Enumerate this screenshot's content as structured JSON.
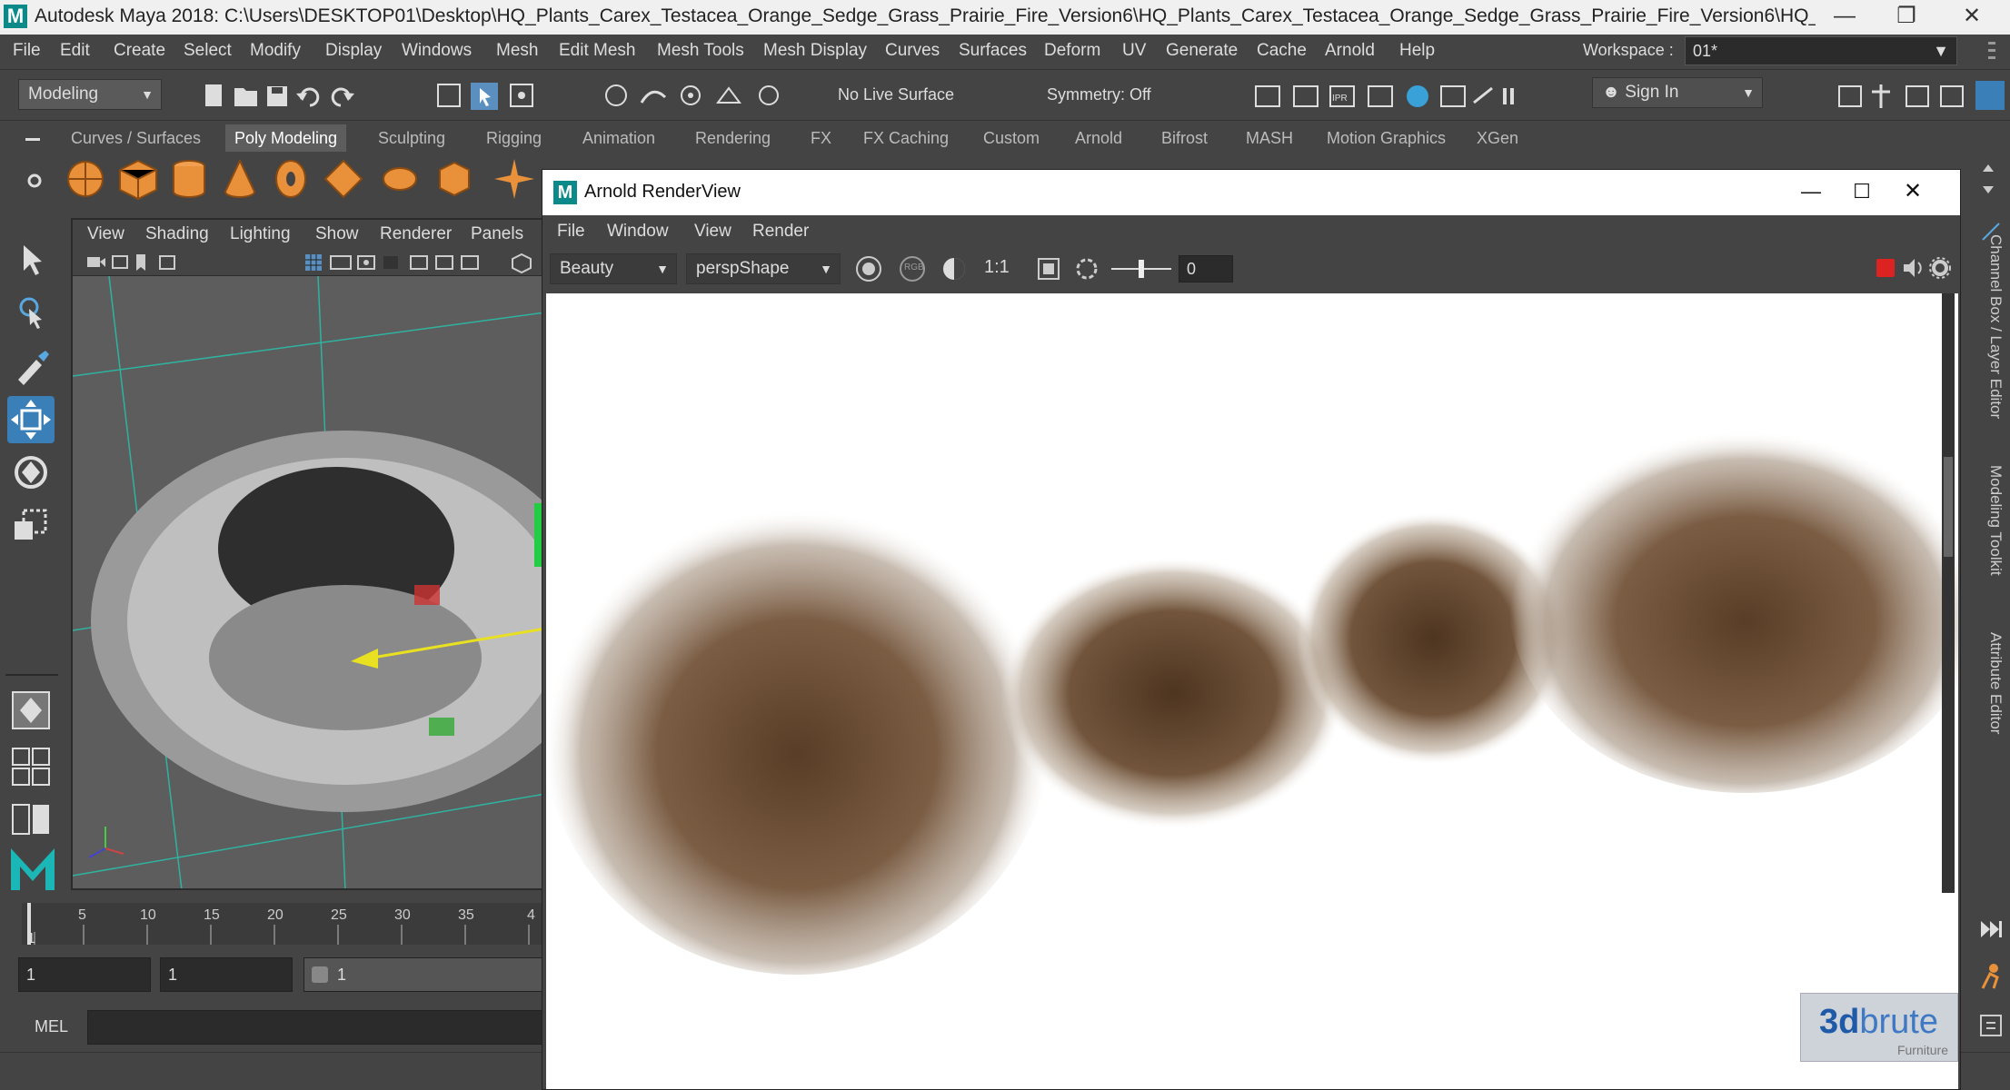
{
  "window": {
    "title": "Autodesk Maya 2018: C:\\Users\\DESKTOP01\\Desktop\\HQ_Plants_Carex_Testacea_Orange_Sedge_Grass_Prairie_Fire_Version6\\HQ_Plants_Carex_Testacea_Orange_Sedge_Grass_Prairie_Fire_Version6\\HQ_Plants_Carex_Testacea_Orang...",
    "logo_letter": "M"
  },
  "menubar": {
    "items": [
      "File",
      "Edit",
      "Create",
      "Select",
      "Modify",
      "Display",
      "Windows",
      "Mesh",
      "Edit Mesh",
      "Mesh Tools",
      "Mesh Display",
      "Curves",
      "Surfaces",
      "Deform",
      "UV",
      "Generate",
      "Cache",
      "Arnold",
      "Help"
    ],
    "workspace_label": "Workspace :",
    "workspace_value": "01*"
  },
  "statusline": {
    "mode": "Modeling",
    "live_surface": "No Live Surface",
    "symmetry": "Symmetry: Off",
    "sign_in": "Sign In"
  },
  "shelf": {
    "tabs": [
      "Curves / Surfaces",
      "Poly Modeling",
      "Sculpting",
      "Rigging",
      "Animation",
      "Rendering",
      "FX",
      "FX Caching",
      "Custom",
      "Arnold",
      "Bifrost",
      "MASH",
      "Motion Graphics",
      "XGen"
    ],
    "active_tab": "Poly Modeling"
  },
  "viewport": {
    "menu": [
      "View",
      "Shading",
      "Lighting",
      "Show",
      "Renderer",
      "Panels"
    ]
  },
  "timeslider": {
    "ticks": [
      "5",
      "10",
      "15",
      "20",
      "25",
      "30",
      "35",
      "4"
    ],
    "current": "1"
  },
  "range": {
    "start": "1",
    "start2": "1",
    "anim_start": "1"
  },
  "command": {
    "label": "MEL"
  },
  "right_panel": {
    "tabs": [
      "Channel Box / Layer Editor",
      "Modeling Toolkit",
      "Attribute Editor"
    ]
  },
  "renderview": {
    "title": "Arnold RenderView",
    "menu": [
      "File",
      "Window",
      "View",
      "Render"
    ],
    "aov": "Beauty",
    "camera": "perspShape",
    "ratio": "1:1",
    "rgb": "RGB",
    "exposure": "0"
  },
  "watermark": {
    "brand_a": "3d",
    "brand_b": "brute",
    "sub": "Furniture"
  },
  "colors": {
    "accent_orange": "#e8913a",
    "maya_teal": "#0c8a8a",
    "active_tool_blue": "#3a7fb8"
  }
}
